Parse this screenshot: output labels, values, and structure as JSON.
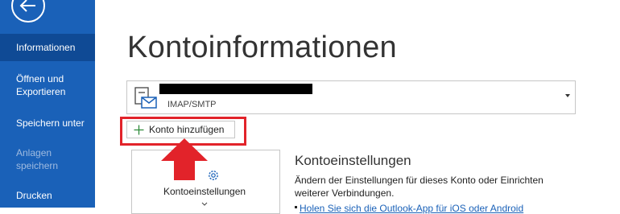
{
  "sidebar": {
    "back_icon": "back-arrow-icon",
    "items": [
      {
        "label": "Informationen",
        "active": true,
        "disabled": false
      },
      {
        "label": "Öffnen und Exportieren",
        "active": false,
        "disabled": false
      },
      {
        "label": "Speichern unter",
        "active": false,
        "disabled": false
      },
      {
        "label": "Anlagen speichern",
        "active": false,
        "disabled": true
      },
      {
        "label": "Drucken",
        "active": false,
        "disabled": false
      }
    ]
  },
  "main": {
    "title": "Kontoinformationen",
    "account": {
      "name": "(redacted)",
      "type": "IMAP/SMTP"
    },
    "add_account_label": "Konto hinzufügen",
    "settings_tile_label": "Kontoeinstellungen",
    "section": {
      "heading": "Kontoeinstellungen",
      "description": "Ändern der Einstellungen für dieses Konto oder Einrichten weiterer Verbindungen.",
      "link": "Holen Sie sich die Outlook-App für iOS oder Android"
    }
  },
  "colors": {
    "sidebar": "#1a61b8",
    "sidebar_active": "#0f4a95",
    "highlight": "#e2232a"
  }
}
